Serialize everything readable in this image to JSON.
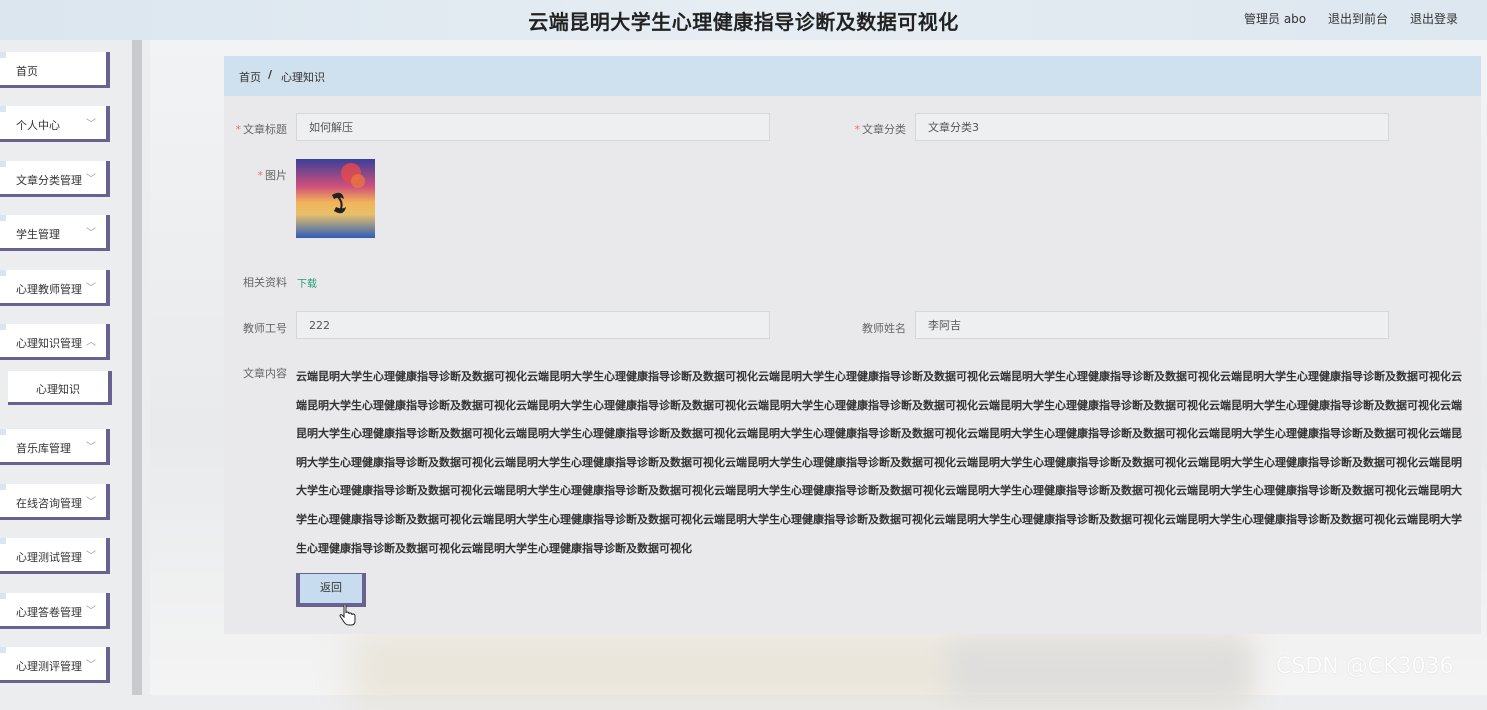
{
  "header": {
    "title": "云端昆明大学生心理健康指导诊断及数据可视化",
    "admin_label": "管理员 abo",
    "front_label": "退出到前台",
    "logout_label": "退出登录"
  },
  "sidebar": {
    "items": [
      {
        "label": "首页"
      },
      {
        "label": "个人中心"
      },
      {
        "label": "文章分类管理"
      },
      {
        "label": "学生管理"
      },
      {
        "label": "心理教师管理"
      },
      {
        "label": "心理知识管理"
      },
      {
        "label": "心理知识"
      },
      {
        "label": "音乐库管理"
      },
      {
        "label": "在线咨询管理"
      },
      {
        "label": "心理测试管理"
      },
      {
        "label": "心理答卷管理"
      },
      {
        "label": "心理测评管理"
      }
    ]
  },
  "breadcrumb": {
    "home": "首页",
    "separator": "/",
    "current": "心理知识"
  },
  "form": {
    "title_label": "文章标题",
    "title_value": "如何解压",
    "category_label": "文章分类",
    "category_value": "文章分类3",
    "image_label": "图片",
    "material_label": "相关资料",
    "download_label": "下载",
    "teacher_id_label": "教师工号",
    "teacher_id_value": "222",
    "teacher_name_label": "教师姓名",
    "teacher_name_value": "李阿吉",
    "content_label": "文章内容",
    "content_value": "云端昆明大学生心理健康指导诊断及数据可视化云端昆明大学生心理健康指导诊断及数据可视化云端昆明大学生心理健康指导诊断及数据可视化云端昆明大学生心理健康指导诊断及数据可视化云端昆明大学生心理健康指导诊断及数据可视化云端昆明大学生心理健康指导诊断及数据可视化云端昆明大学生心理健康指导诊断及数据可视化云端昆明大学生心理健康指导诊断及数据可视化云端昆明大学生心理健康指导诊断及数据可视化云端昆明大学生心理健康指导诊断及数据可视化云端昆明大学生心理健康指导诊断及数据可视化云端昆明大学生心理健康指导诊断及数据可视化云端昆明大学生心理健康指导诊断及数据可视化云端昆明大学生心理健康指导诊断及数据可视化云端昆明大学生心理健康指导诊断及数据可视化云端昆明大学生心理健康指导诊断及数据可视化云端昆明大学生心理健康指导诊断及数据可视化云端昆明大学生心理健康指导诊断及数据可视化云端昆明大学生心理健康指导诊断及数据可视化云端昆明大学生心理健康指导诊断及数据可视化云端昆明大学生心理健康指导诊断及数据可视化云端昆明大学生心理健康指导诊断及数据可视化云端昆明大学生心理健康指导诊断及数据可视化云端昆明大学生心理健康指导诊断及数据可视化云端昆明大学生心理健康指导诊断及数据可视化云端昆明大学生心理健康指导诊断及数据可视化云端昆明大学生心理健康指导诊断及数据可视化云端昆明大学生心理健康指导诊断及数据可视化云端昆明大学生心理健康指导诊断及数据可视化云端昆明大学生心理健康指导诊断及数据可视化云端昆明大学生心理健康指导诊断及数据可视化云端昆明大学生心理健康指导诊断及数据可视化",
    "back_label": "返回"
  },
  "watermark": "CSDN @CK3036",
  "colors": {
    "accent_border": "#67628f",
    "breadcrumb_bg": "#cfe0ee",
    "button_bg": "#c8dcef",
    "download_link": "#2c9a7c",
    "required": "#f56c6c"
  }
}
